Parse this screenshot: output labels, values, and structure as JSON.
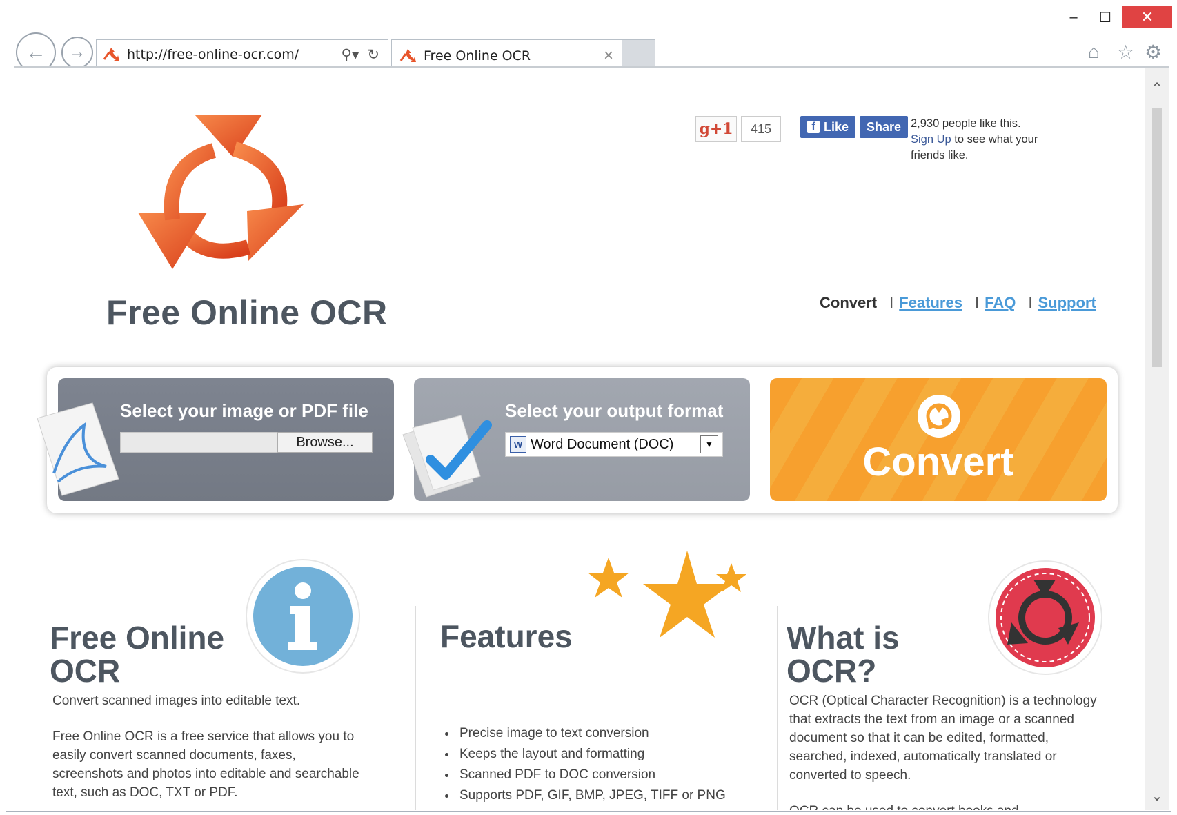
{
  "browser": {
    "address_url": "http://free-online-ocr.com/",
    "tab_title": "Free Online OCR",
    "icons": {
      "back": "back-arrow-icon",
      "forward": "forward-arrow-icon",
      "search": "search-icon",
      "refresh": "refresh-icon",
      "home": "home-icon",
      "favorites": "star-icon",
      "settings": "gear-icon"
    },
    "window_controls": {
      "minimize": "–",
      "maximize": "☐",
      "close": "✕"
    },
    "tab_close": "×"
  },
  "header": {
    "site_name": "Free Online OCR",
    "gplus": {
      "label": "g+1",
      "count": "415"
    },
    "facebook": {
      "like_label": "Like",
      "share_label": "Share",
      "like_count_text": "2,930 people like this.",
      "signup_link": "Sign Up",
      "signup_suffix": " to see what your friends like."
    },
    "nav": {
      "current": "Convert",
      "separator": "I",
      "links": [
        "Features",
        "FAQ",
        "Support"
      ]
    }
  },
  "converter": {
    "file_panel_title": "Select your image or PDF file",
    "file_value": "",
    "browse_label": "Browse...",
    "format_panel_title": "Select your output format",
    "format_selected": "Word Document (DOC)",
    "convert_label": "Convert",
    "colors": {
      "file_panel": "#7a808b",
      "format_panel": "#9ea3ac",
      "convert_panel": "#f7a02e"
    }
  },
  "sections": {
    "about": {
      "title": "Free Online OCR",
      "intro": "Convert scanned images into editable text.",
      "body": "Free Online OCR is a free service that allows you to easily convert scanned documents, faxes, screenshots and photos into editable and searchable text, such as DOC, TXT or PDF."
    },
    "features": {
      "title": "Features",
      "items": [
        "Precise image to text conversion",
        "Keeps the layout and formatting",
        "Scanned PDF to DOC conversion",
        "Supports PDF, GIF, BMP, JPEG, TIFF or PNG"
      ]
    },
    "what_is_ocr": {
      "title": "What is OCR?",
      "body1": "OCR (Optical Character Recognition) is a technology that extracts the text from an image or a scanned document so that it can be edited, formatted, searched, indexed, automatically translated or converted to speech.",
      "body2": "OCR can be used to convert books and"
    }
  }
}
